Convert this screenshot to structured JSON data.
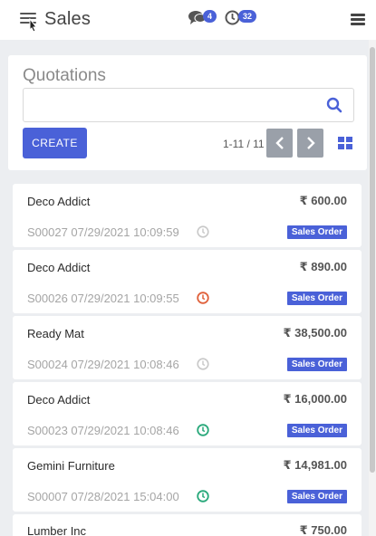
{
  "header": {
    "title": "Sales",
    "messages_count": "4",
    "activities_count": "32"
  },
  "panel": {
    "title": "Quotations",
    "search_value": "",
    "create_label": "CREATE",
    "pager": "1-11 / 11"
  },
  "colors": {
    "accent": "#4a61d8",
    "activity_overdue": "#e0603a",
    "activity_today": "#28a87a",
    "activity_none": "#c8c8c8"
  },
  "cards": [
    {
      "name": "Deco Addict",
      "amount": "₹ 600.00",
      "ref": "S00027 07/29/2021 10:09:59",
      "activity": "none",
      "status": "Sales Order"
    },
    {
      "name": "Deco Addict",
      "amount": "₹ 890.00",
      "ref": "S00026 07/29/2021 10:09:55",
      "activity": "overdue",
      "status": "Sales Order"
    },
    {
      "name": "Ready Mat",
      "amount": "₹ 38,500.00",
      "ref": "S00024 07/29/2021 10:08:46",
      "activity": "none",
      "status": "Sales Order"
    },
    {
      "name": "Deco Addict",
      "amount": "₹ 16,000.00",
      "ref": "S00023 07/29/2021 10:08:46",
      "activity": "today",
      "status": "Sales Order"
    },
    {
      "name": "Gemini Furniture",
      "amount": "₹ 14,981.00",
      "ref": "S00007 07/28/2021 15:04:00",
      "activity": "today",
      "status": "Sales Order"
    },
    {
      "name": "Lumber Inc",
      "amount": "₹ 750.00",
      "ref": "",
      "activity": "",
      "status": ""
    }
  ]
}
